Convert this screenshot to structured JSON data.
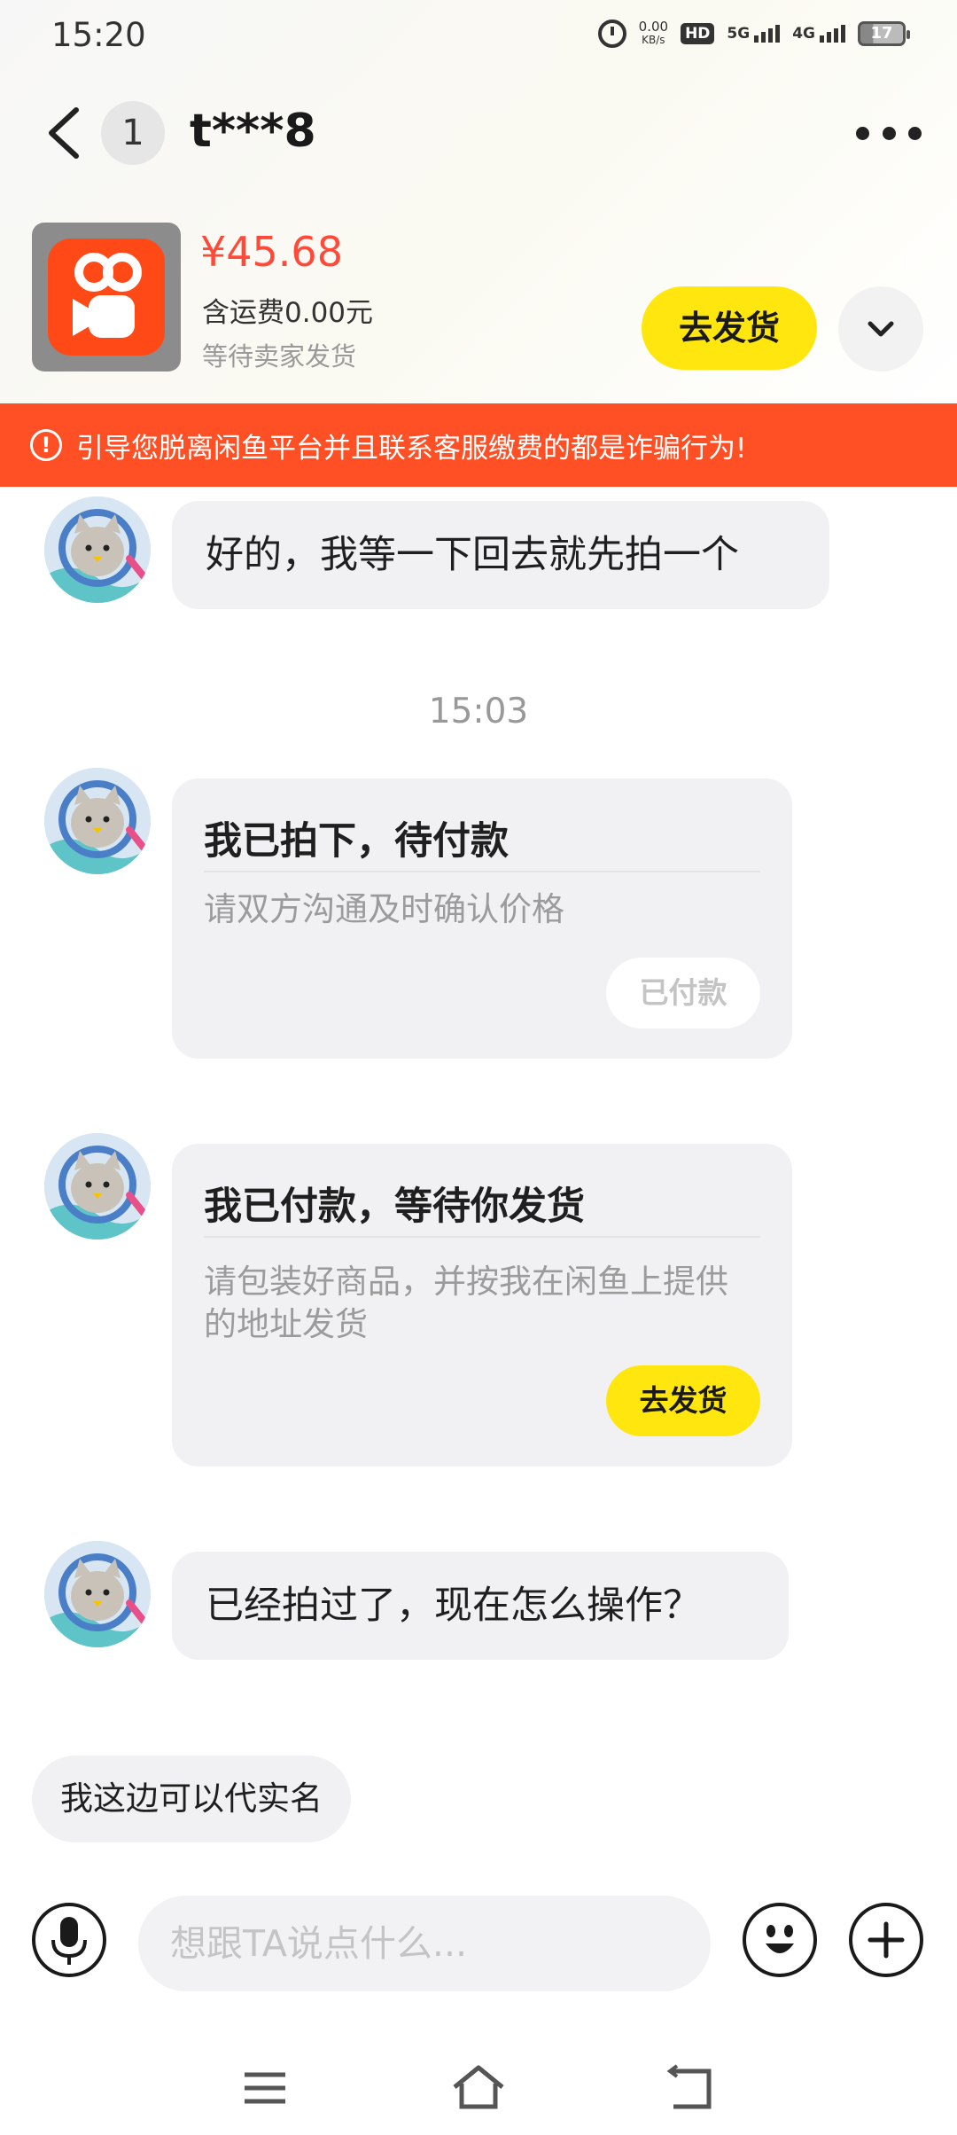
{
  "status_bar": {
    "time": "15:20",
    "speed_value": "0.00",
    "speed_unit": "KB/s",
    "hd_label": "HD",
    "net1_label": "5G",
    "net2_label": "4G",
    "battery": "17"
  },
  "header": {
    "unread_count": "1",
    "peer_name": "t***8"
  },
  "product": {
    "price": "¥45.68",
    "shipping": "含运费0.00元",
    "status": "等待卖家发货",
    "ship_button": "去发货"
  },
  "warning": {
    "icon": "!",
    "text": "引导您脱离闲鱼平台并且联系客服缴费的都是诈骗行为!"
  },
  "messages": {
    "msg1": "好的，我等一下回去就先拍一个",
    "time_separator": "15:03",
    "card1": {
      "title": "我已拍下，待付款",
      "desc": "请双方沟通及时确认价格",
      "button": "已付款"
    },
    "card2": {
      "title": "我已付款，等待你发货",
      "desc": "请包装好商品，并按我在闲鱼上提供的地址发货",
      "button": "去发货"
    },
    "msg2": "已经拍过了，现在怎么操作？",
    "outgoing": "我这边可以代实名"
  },
  "input": {
    "placeholder": "想跟TA说点什么..."
  },
  "icons": {
    "back": "chevron-left-icon",
    "more": "more-dots-icon",
    "expand": "chevron-down-icon",
    "voice": "microphone-icon",
    "emoji": "emoji-icon",
    "plus": "plus-icon",
    "nav_menu": "menu-icon",
    "nav_home": "home-icon",
    "nav_back": "back-return-icon"
  },
  "colors": {
    "accent_yellow": "#ffe60f",
    "price_red": "#ff4a3a",
    "warning_bg": "#ff4f24",
    "bubble_bg": "#f1f1f3"
  }
}
